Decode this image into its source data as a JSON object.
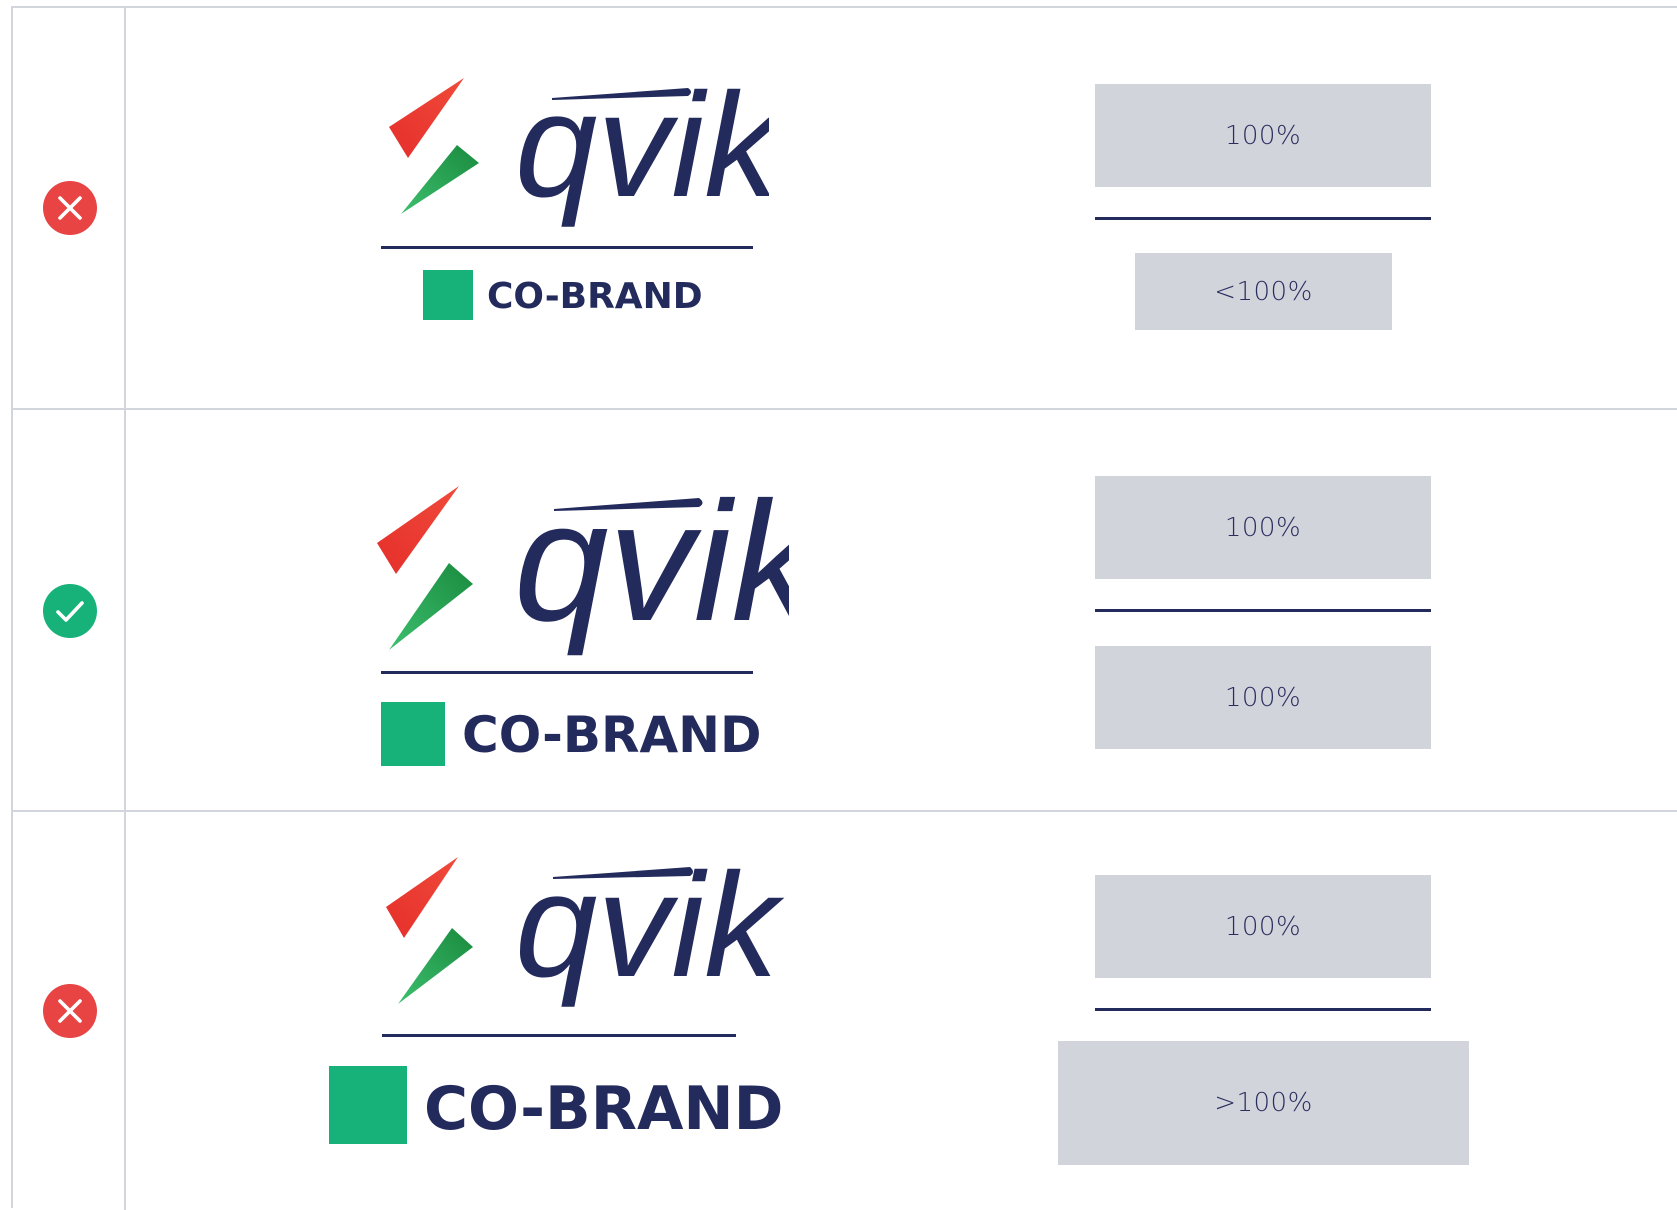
{
  "colors": {
    "navy": "#232a5c",
    "green": "#16b27a",
    "red_status": "#e84444",
    "green_status": "#16b27a",
    "bar_gray": "#d2d4dc",
    "grid_line": "#d3d5dc"
  },
  "brand": {
    "wordmark": "qvik",
    "cobrand": "CO-BRAND"
  },
  "rows": [
    {
      "status": "incorrect",
      "status_icon": "x-icon",
      "top_bar": "100%",
      "bottom_bar": "<100%"
    },
    {
      "status": "correct",
      "status_icon": "check-icon",
      "top_bar": "100%",
      "bottom_bar": "100%"
    },
    {
      "status": "incorrect",
      "status_icon": "x-icon",
      "top_bar": "100%",
      "bottom_bar": ">100%"
    }
  ]
}
